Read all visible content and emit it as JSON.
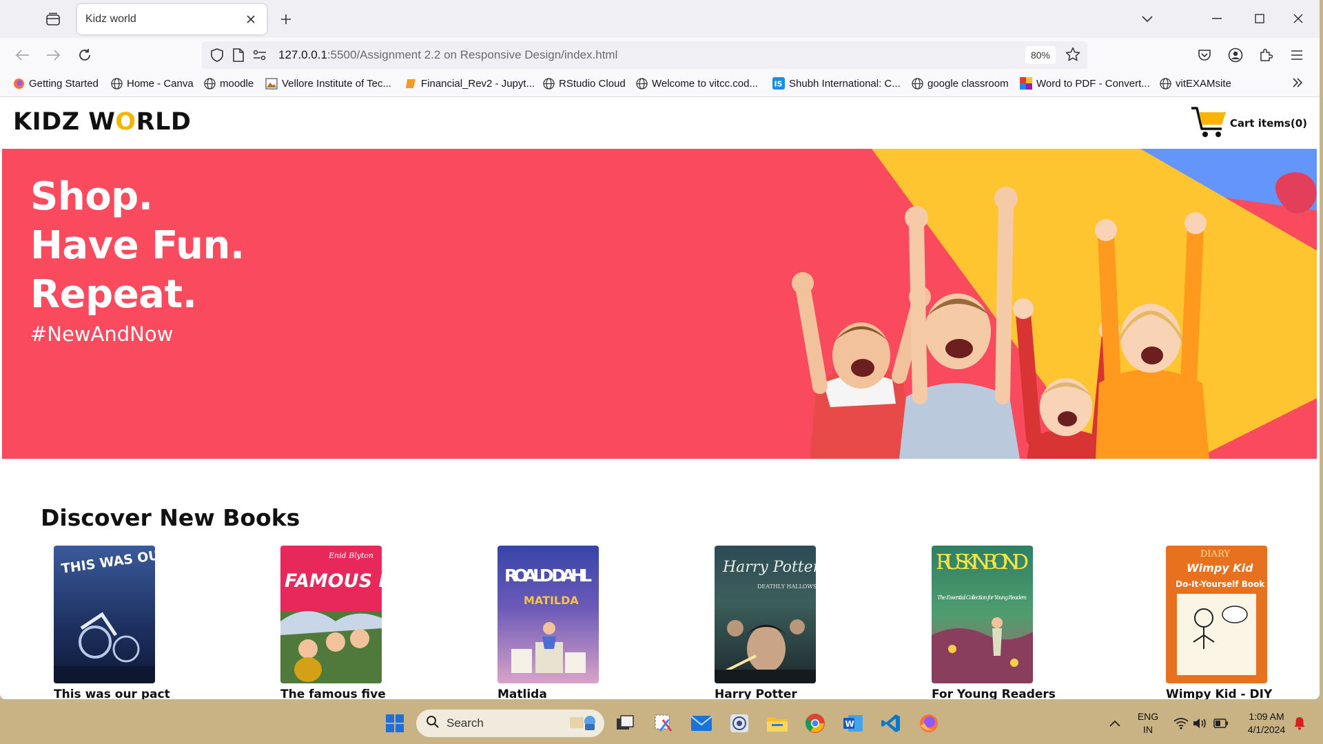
{
  "browser": {
    "tab": {
      "title": "Kidz world"
    },
    "address": {
      "host": "127.0.0.1",
      "path": ":5500/Assignment 2.2 on Responsive Design/index.html",
      "zoom": "80%"
    },
    "bookmarks": [
      {
        "label": "Getting Started",
        "icon": "firefox-icon"
      },
      {
        "label": "Home - Canva",
        "icon": "globe-icon"
      },
      {
        "label": "moodle",
        "icon": "globe-icon"
      },
      {
        "label": "Vellore Institute of Tec...",
        "icon": "image-icon"
      },
      {
        "label": "Financial_Rev2 - Jupyt...",
        "icon": "notebook-icon"
      },
      {
        "label": "RStudio Cloud",
        "icon": "globe-icon"
      },
      {
        "label": "Welcome to vitcc.cod...",
        "icon": "globe-icon"
      },
      {
        "label": "Shubh International: C...",
        "icon": "is-logo-icon"
      },
      {
        "label": "google classroom",
        "icon": "globe-icon"
      },
      {
        "label": "Word to PDF - Convert...",
        "icon": "colorful-grid-icon"
      },
      {
        "label": "vitEXAMsite",
        "icon": "globe-icon"
      }
    ]
  },
  "site": {
    "logo_pre": "KIDZ W",
    "logo_o": "O",
    "logo_post": "RLD",
    "cart_label": "Cart items(0)",
    "hero": {
      "line1": "Shop.",
      "line2": "Have Fun.",
      "line3": "Repeat.",
      "tag": "#NewAndNow"
    },
    "books_heading": "Discover New Books",
    "books": [
      {
        "title": "This was our pact",
        "cover_text": "THIS WAS OUR PACT"
      },
      {
        "title": "The famous five",
        "cover_text": "FAMOUS FIVE",
        "cover_small": "Enid Blyton"
      },
      {
        "title": "Matlida",
        "cover_text": "ROALD DAHL",
        "cover_small": "MATILDA"
      },
      {
        "title": "Harry Potter",
        "cover_text": "Harry Potter",
        "cover_small": "DEATHLY HALLOWS"
      },
      {
        "title": "For Young Readers",
        "cover_text": "RUSKIN BOND",
        "cover_small": "The Essential Collection for Young Readers"
      },
      {
        "title": "Wimpy Kid - DIY",
        "cover_text": "Wimpy Kid",
        "cover_small": "DIARY",
        "cover_small2": "Do-It-Yourself Book"
      }
    ]
  },
  "taskbar": {
    "search_label": "Search",
    "lang_line1": "ENG",
    "lang_line2": "IN",
    "time": "1:09 AM",
    "date": "4/1/2024"
  },
  "colors": {
    "hero_bg": "#fa4a5d",
    "hero_yellow": "#ffc531",
    "hero_blue": "#6395fb",
    "logo_accent": "#f4b400",
    "taskbar": "#c9b384"
  }
}
